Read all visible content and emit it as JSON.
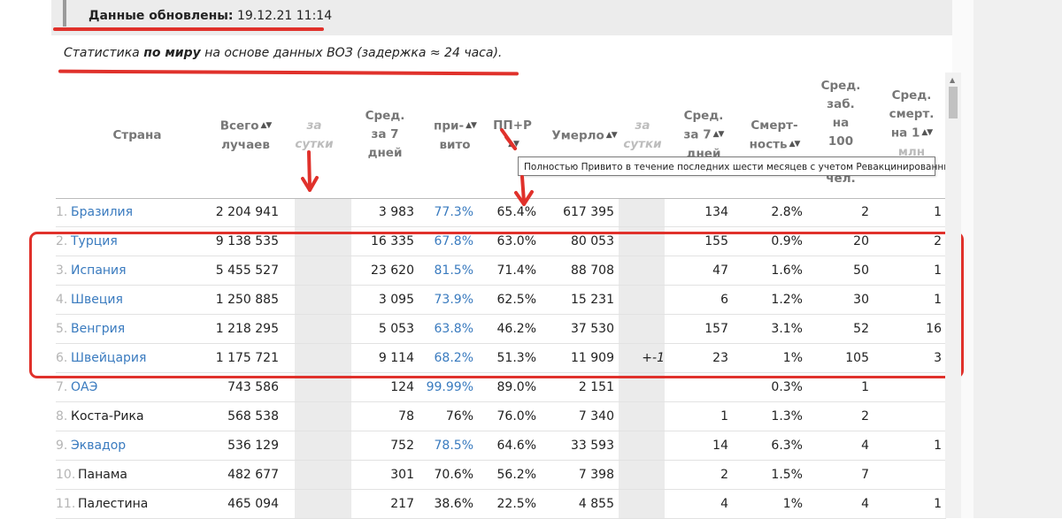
{
  "header": {
    "updated_label": "Данные обновлены:",
    "updated_value": "19.12.21 11:14"
  },
  "stats_line": {
    "part1": "Статистика ",
    "bold": "по миру",
    "part2": " на основе данных ВОЗ (задержка ≈ 24 часа)."
  },
  "columns": {
    "country": "Страна",
    "total_l1": "Всего",
    "total_l2": "лучаев",
    "day1_l1": "за",
    "day1_l2": "сутки",
    "avg7_l1": "Сред.",
    "avg7_l2": "за 7",
    "avg7_l3": "дней",
    "vacc_l1": "при-",
    "vacc_l2": "вито",
    "ppr": "ПП+Р",
    "died": "Умерло",
    "day2_l1": "за",
    "day2_l2": "сутки",
    "avg7d_l1": "Сред.",
    "avg7d_l2": "за 7",
    "avg7d_l3": "дней",
    "mort_l1": "Смерт-",
    "mort_l2": "ность",
    "inc_l1": "Сред.",
    "inc_l2": "заб.",
    "inc_l3": "на",
    "inc_l4": "100",
    "inc_l5": "чел.",
    "dm_l1": "Сред.",
    "dm_l2": "смерт.",
    "dm_l3": "на 1",
    "dm_l4": "млн"
  },
  "tooltip": "Полностью Привито в течение последних шести месяцев с учетом Ревакцинированных.",
  "rows": [
    {
      "rank": "1.",
      "country": "Бразилия",
      "linked": true,
      "total": "2 204 941",
      "day": "",
      "avg7": "3 983",
      "vacc": "77.3%",
      "vacc_linked": true,
      "ppr": "65.4%",
      "died": "617 395",
      "day_d": "",
      "avg7_d": "134",
      "mort": "2.8%",
      "inc": "2",
      "dm": "1"
    },
    {
      "rank": "2.",
      "country": "Турция",
      "linked": true,
      "total": "9 138 535",
      "day": "",
      "avg7": "16 335",
      "vacc": "67.8%",
      "vacc_linked": true,
      "ppr": "63.0%",
      "died": "80 053",
      "day_d": "",
      "avg7_d": "155",
      "mort": "0.9%",
      "inc": "20",
      "dm": "2"
    },
    {
      "rank": "3.",
      "country": "Испания",
      "linked": true,
      "total": "5 455 527",
      "day": "",
      "avg7": "23 620",
      "vacc": "81.5%",
      "vacc_linked": true,
      "ppr": "71.4%",
      "died": "88 708",
      "day_d": "",
      "avg7_d": "47",
      "mort": "1.6%",
      "inc": "50",
      "dm": "1"
    },
    {
      "rank": "4.",
      "country": "Швеция",
      "linked": true,
      "total": "1 250 885",
      "day": "",
      "avg7": "3 095",
      "vacc": "73.9%",
      "vacc_linked": true,
      "ppr": "62.5%",
      "died": "15 231",
      "day_d": "",
      "avg7_d": "6",
      "mort": "1.2%",
      "inc": "30",
      "dm": "1"
    },
    {
      "rank": "5.",
      "country": "Венгрия",
      "linked": true,
      "total": "1 218 295",
      "day": "",
      "avg7": "5 053",
      "vacc": "63.8%",
      "vacc_linked": true,
      "ppr": "46.2%",
      "died": "37 530",
      "day_d": "",
      "avg7_d": "157",
      "mort": "3.1%",
      "inc": "52",
      "dm": "16"
    },
    {
      "rank": "6.",
      "country": "Швейцария",
      "linked": true,
      "total": "1 175 721",
      "day": "",
      "avg7": "9 114",
      "vacc": "68.2%",
      "vacc_linked": true,
      "ppr": "51.3%",
      "died": "11 909",
      "day_d": "+-1",
      "avg7_d": "23",
      "mort": "1%",
      "inc": "105",
      "dm": "3"
    },
    {
      "rank": "7.",
      "country": "ОАЭ",
      "linked": true,
      "total": "743 586",
      "day": "",
      "avg7": "124",
      "vacc": "99.99%",
      "vacc_linked": true,
      "ppr": "89.0%",
      "died": "2 151",
      "day_d": "",
      "avg7_d": "",
      "mort": "0.3%",
      "inc": "1",
      "dm": ""
    },
    {
      "rank": "8.",
      "country": "Коста-Рика",
      "linked": false,
      "total": "568 538",
      "day": "",
      "avg7": "78",
      "vacc": "76%",
      "vacc_linked": false,
      "ppr": "76.0%",
      "died": "7 340",
      "day_d": "",
      "avg7_d": "1",
      "mort": "1.3%",
      "inc": "2",
      "dm": ""
    },
    {
      "rank": "9.",
      "country": "Эквадор",
      "linked": true,
      "total": "536 129",
      "day": "",
      "avg7": "752",
      "vacc": "78.5%",
      "vacc_linked": true,
      "ppr": "64.6%",
      "died": "33 593",
      "day_d": "",
      "avg7_d": "14",
      "mort": "6.3%",
      "inc": "4",
      "dm": "1"
    },
    {
      "rank": "10.",
      "country": "Панама",
      "linked": false,
      "total": "482 677",
      "day": "",
      "avg7": "301",
      "vacc": "70.6%",
      "vacc_linked": false,
      "ppr": "56.2%",
      "died": "7 398",
      "day_d": "",
      "avg7_d": "2",
      "mort": "1.5%",
      "inc": "7",
      "dm": ""
    },
    {
      "rank": "11.",
      "country": "Палестина",
      "linked": false,
      "total": "465 094",
      "day": "",
      "avg7": "217",
      "vacc": "38.6%",
      "vacc_linked": false,
      "ppr": "22.5%",
      "died": "4 855",
      "day_d": "",
      "avg7_d": "4",
      "mort": "1%",
      "inc": "4",
      "dm": "1"
    }
  ],
  "colors": {
    "annotation_red": "#e0312b",
    "link_blue": "#3a7bbf",
    "shaded_column": "#ebebeb"
  }
}
